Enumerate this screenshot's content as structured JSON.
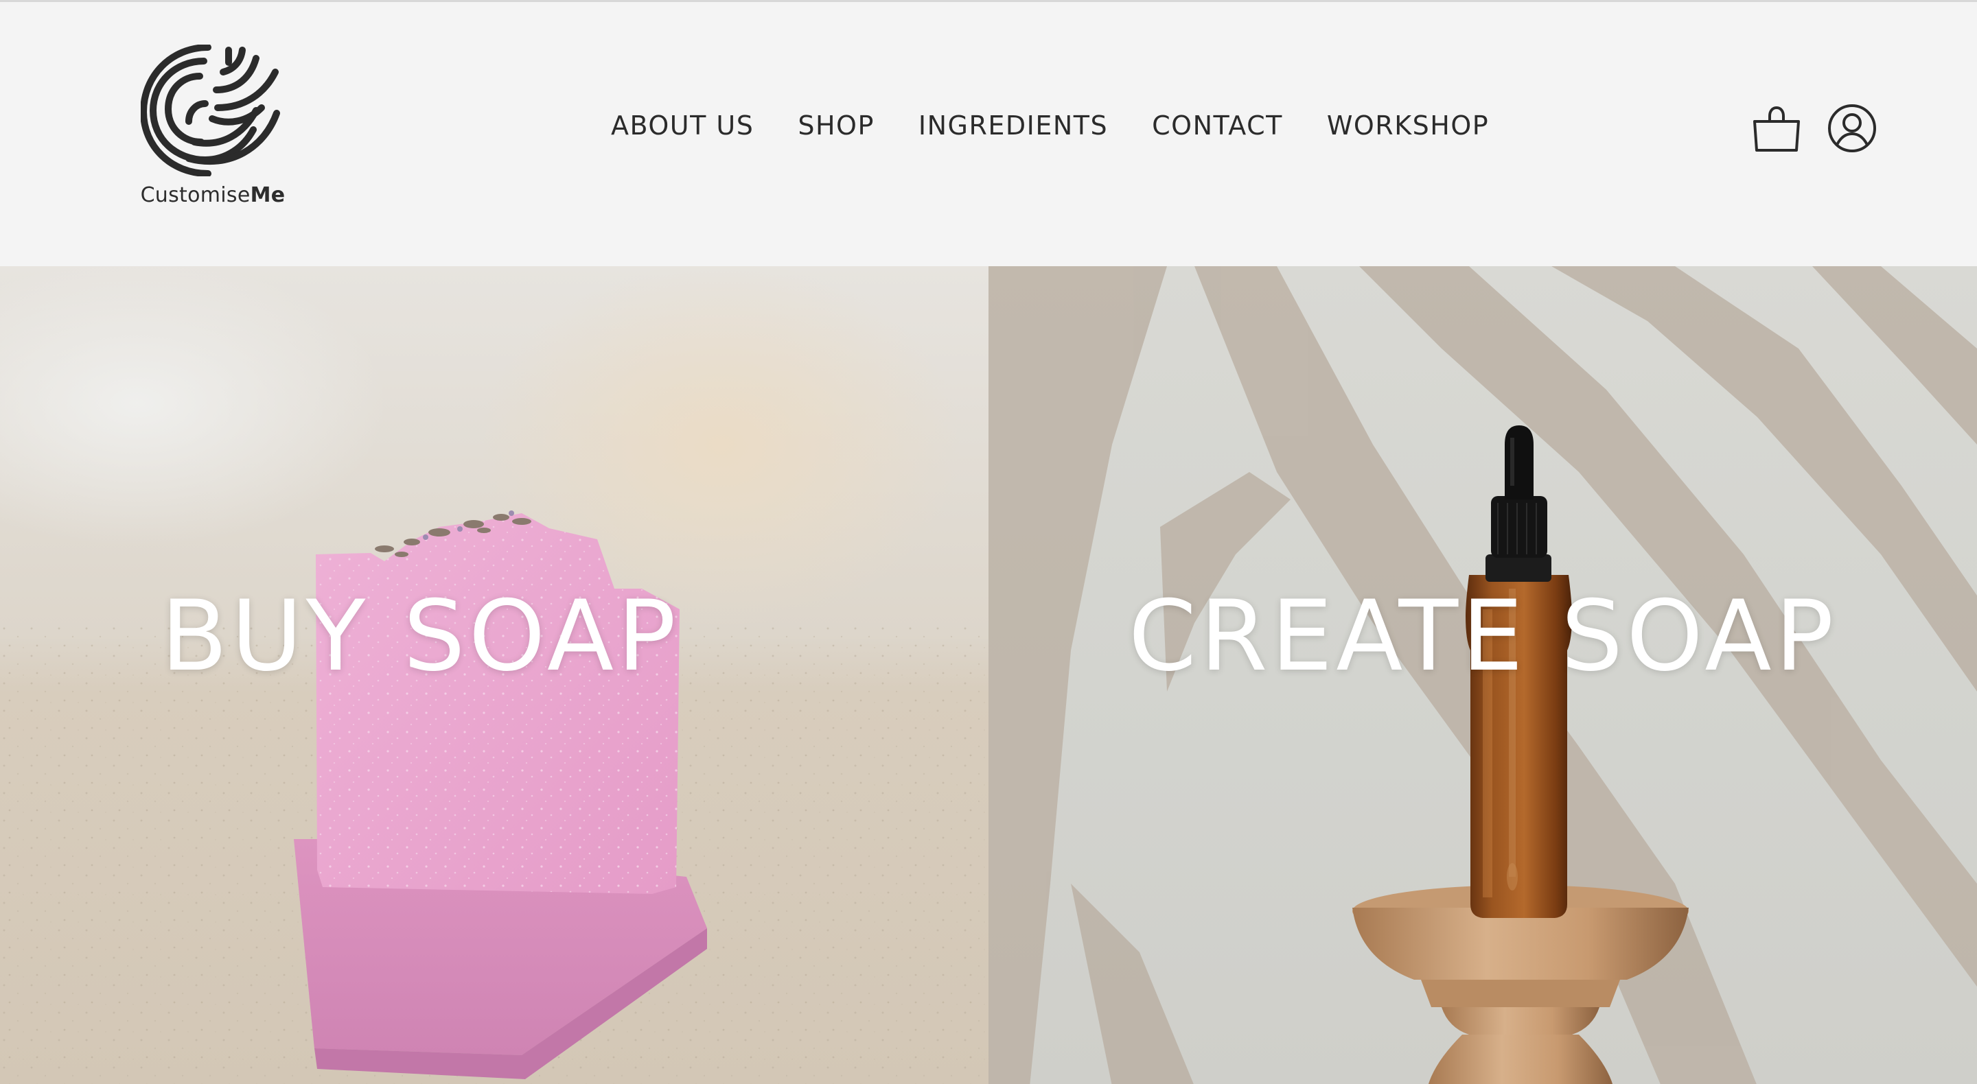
{
  "brand": {
    "name_regular": "Customise",
    "name_bold": "Me"
  },
  "nav": {
    "items": [
      {
        "label": "ABOUT US"
      },
      {
        "label": "SHOP"
      },
      {
        "label": "INGREDIENTS"
      },
      {
        "label": "CONTACT"
      },
      {
        "label": "WORKSHOP"
      }
    ]
  },
  "header_icons": {
    "cart": "shopping-bag-icon",
    "account": "user-account-icon"
  },
  "hero": {
    "left_title": "BUY SOAP",
    "right_title": "CREATE SOAP"
  },
  "colors": {
    "header_bg": "#f4f4f4",
    "text_dark": "#2b2b2b",
    "hero_text": "#ffffff",
    "soap_pink": "#e9a7cf"
  }
}
